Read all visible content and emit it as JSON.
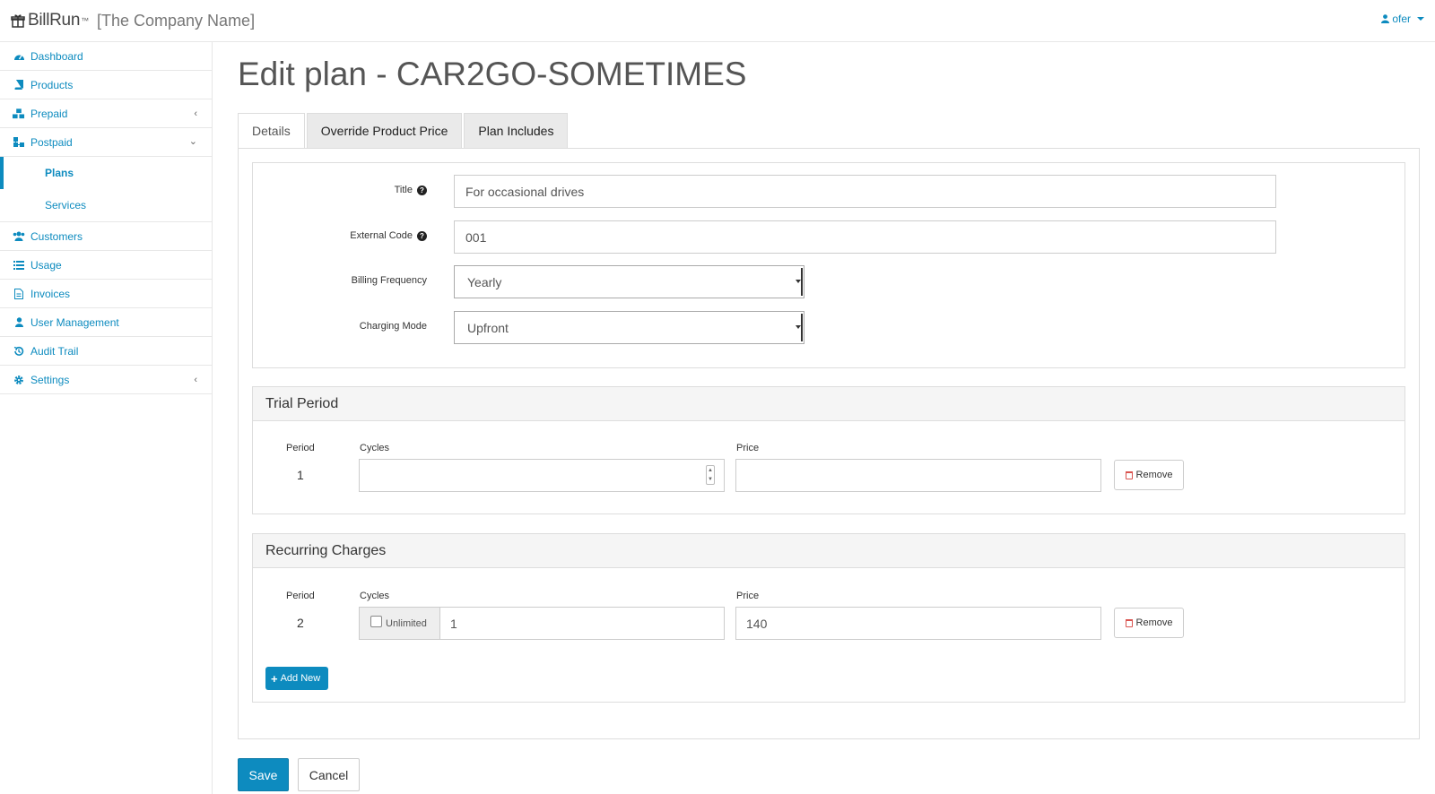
{
  "header": {
    "brand": "BillRun",
    "brand_mark": "™",
    "company": "[The Company Name]",
    "user": "ofer"
  },
  "sidebar": {
    "items": [
      {
        "label": "Dashboard",
        "icon": "dashboard-icon"
      },
      {
        "label": "Products",
        "icon": "book-icon"
      },
      {
        "label": "Prepaid",
        "icon": "cubes-icon",
        "arrow": "‹"
      },
      {
        "label": "Postpaid",
        "icon": "sitemap-icon",
        "arrow": "⌄"
      },
      {
        "label": "Customers",
        "icon": "users-icon"
      },
      {
        "label": "Usage",
        "icon": "list-icon"
      },
      {
        "label": "Invoices",
        "icon": "file-icon"
      },
      {
        "label": "User Management",
        "icon": "user-icon"
      },
      {
        "label": "Audit Trail",
        "icon": "history-icon"
      },
      {
        "label": "Settings",
        "icon": "gear-icon",
        "arrow": "‹"
      }
    ],
    "postpaid_sub": [
      {
        "label": "Plans",
        "active": true
      },
      {
        "label": "Services",
        "active": false
      }
    ]
  },
  "main": {
    "title": "Edit plan - CAR2GO-SOMETIMES",
    "tabs": [
      {
        "label": "Details",
        "active": true
      },
      {
        "label": "Override Product Price",
        "active": false
      },
      {
        "label": "Plan Includes",
        "active": false
      }
    ],
    "form": {
      "title_label": "Title",
      "title_value": "For occasional drives",
      "external_code_label": "External Code",
      "external_code_value": "001",
      "billing_frequency_label": "Billing Frequency",
      "billing_frequency_value": "Yearly",
      "charging_mode_label": "Charging Mode",
      "charging_mode_value": "Upfront"
    },
    "trial_period": {
      "heading": "Trial Period",
      "col_period": "Period",
      "col_cycles": "Cycles",
      "col_price": "Price",
      "period": "1",
      "cycles": "",
      "price": "",
      "remove_label": "Remove"
    },
    "recurring_charges": {
      "heading": "Recurring Charges",
      "col_period": "Period",
      "col_cycles": "Cycles",
      "col_price": "Price",
      "period": "2",
      "unlimited_label": "Unlimited",
      "unlimited_checked": false,
      "cycles": "1",
      "price": "140",
      "remove_label": "Remove",
      "add_new_label": "Add New"
    }
  },
  "actions": {
    "save": "Save",
    "cancel": "Cancel"
  },
  "colors": {
    "accent": "#0d8bbf",
    "danger": "#d9534f"
  }
}
